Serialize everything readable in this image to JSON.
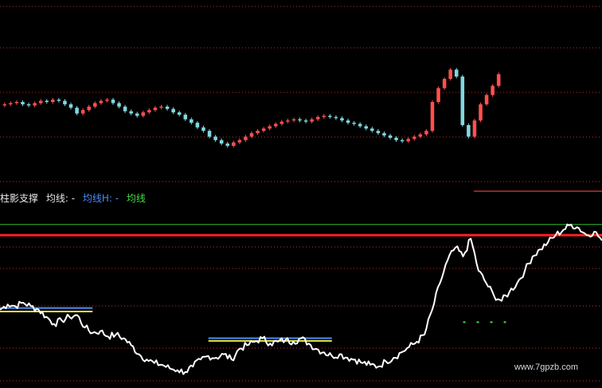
{
  "indicator": {
    "name": "柱影支撑",
    "legend": [
      {
        "label": "均线: -",
        "color": "#e8e8e8"
      },
      {
        "label": "均线H: -",
        "color": "#4a8cff"
      },
      {
        "label": "均线",
        "color": "#40e040"
      }
    ]
  },
  "watermark": "www.7gpzb.com",
  "colors": {
    "background": "#000000",
    "bull_candle": "#ff5050",
    "bear_candle": "#80d8e0",
    "grid": "#c03030",
    "main_line": "#ffffff",
    "upper_line": "#30c030",
    "red_level": "#ff2020",
    "blue_ma": "#4a8cff",
    "yellow_ma": "#e8e840"
  },
  "chart_data": [
    {
      "type": "candlestick",
      "name": "price",
      "ylim": [
        0,
        100
      ],
      "grid": "dotted horizontal",
      "levels": [
        {
          "y": 23,
          "style": "solid",
          "color": "#c03030"
        }
      ],
      "closes": [
        58,
        59,
        60,
        58,
        57,
        59,
        61,
        60,
        62,
        61,
        58,
        55,
        50,
        53,
        56,
        59,
        61,
        62,
        59,
        56,
        52,
        50,
        48,
        51,
        53,
        55,
        56,
        54,
        51,
        49,
        45,
        42,
        38,
        35,
        30,
        27,
        24,
        22,
        25,
        27,
        30,
        33,
        35,
        37,
        39,
        41,
        43,
        44,
        45,
        44,
        43,
        45,
        47,
        48,
        47,
        46,
        44,
        42,
        41,
        39,
        37,
        35,
        33,
        31,
        29,
        27,
        26,
        28,
        30,
        32,
        35,
        60,
        72,
        80,
        88,
        82,
        40,
        30,
        44,
        58,
        66,
        74,
        84
      ]
    },
    {
      "type": "line",
      "name": "indicator",
      "ylim": [
        0,
        100
      ],
      "grid": "dotted horizontal",
      "levels": [
        {
          "y": 88,
          "style": "solid",
          "color": "#30c030"
        },
        {
          "y": 82,
          "style": "solid",
          "color": "#ff2020"
        }
      ],
      "series": [
        {
          "name": "main",
          "values": [
            40,
            43,
            42,
            44,
            42,
            40,
            36,
            32,
            34,
            36,
            37,
            30,
            27,
            28,
            25,
            26,
            24,
            20,
            15,
            12,
            10,
            9,
            7,
            6,
            5,
            8,
            12,
            14,
            13,
            15,
            12,
            18,
            20,
            22,
            24,
            21,
            22,
            23,
            22,
            24,
            21,
            18,
            16,
            14,
            15,
            13,
            12,
            10,
            9,
            8,
            11,
            13,
            16,
            19,
            22,
            26,
            40,
            55,
            68,
            75,
            70,
            80,
            62,
            55,
            48,
            45,
            50,
            55,
            62,
            70,
            74,
            78,
            82,
            85,
            88,
            86,
            82,
            84,
            79
          ]
        }
      ],
      "ma_segments": [
        {
          "color": "#4a8cff",
          "from": 0,
          "to": 12,
          "y": 41
        },
        {
          "color": "#e8e840",
          "from": 0,
          "to": 12,
          "y": 39
        },
        {
          "color": "#4a8cff",
          "from": 27,
          "to": 43,
          "y": 24
        },
        {
          "color": "#e8e840",
          "from": 27,
          "to": 43,
          "y": 22.5
        },
        {
          "color": "#40e040",
          "from": 60,
          "to": 66,
          "y": 33
        }
      ]
    }
  ]
}
